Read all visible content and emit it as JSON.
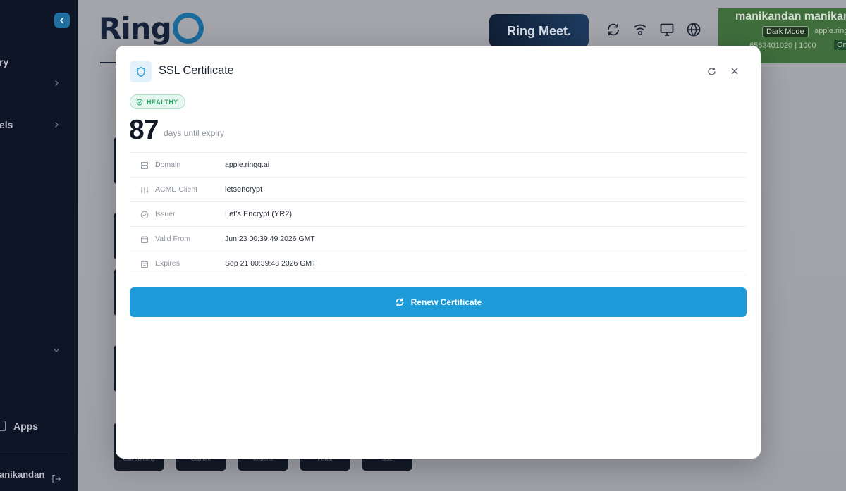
{
  "sidebar": {
    "items": [
      {
        "label": "ry"
      },
      {
        "label": "els"
      },
      {
        "label": "Apps"
      }
    ],
    "user_label": "anikandan"
  },
  "header": {
    "logo_text": "Ring",
    "meet_text": "Ring Meet.",
    "user": {
      "name": "manikandan manikan",
      "dark_mode_label": "Dark Mode",
      "domain": "apple.ring",
      "extension_text": "6563401020   |   1000",
      "status": "On"
    }
  },
  "tiles": [
    {
      "label": "Call Bonding"
    },
    {
      "label": "Capture"
    },
    {
      "label": "Reports"
    },
    {
      "label": "Portal"
    },
    {
      "label": "SSL"
    }
  ],
  "modal": {
    "title": "SSL Certificate",
    "status_badge": "HEALTHY",
    "days_value": "87",
    "days_label": "days until expiry",
    "details": [
      {
        "icon": "server-icon",
        "label": "Domain",
        "value": "apple.ringq.ai"
      },
      {
        "icon": "sliders-icon",
        "label": "ACME Client",
        "value": "letsencrypt"
      },
      {
        "icon": "check-circle-icon",
        "label": "Issuer",
        "value": "Let's Encrypt (YR2)"
      },
      {
        "icon": "calendar-icon",
        "label": "Valid From",
        "value": "Jun 23 00:39:49 2026 GMT"
      },
      {
        "icon": "calendar-icon",
        "label": "Expires",
        "value": "Sep 21 00:39:48 2026 GMT"
      }
    ],
    "renew_label": "Renew Certificate"
  },
  "colors": {
    "accent": "#1d9ad8",
    "healthy": "#27a567",
    "sidebar": "#0d1526"
  }
}
